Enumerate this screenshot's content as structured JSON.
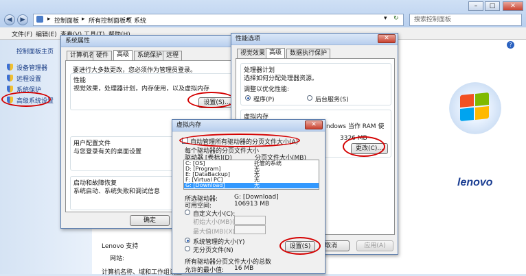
{
  "window": {
    "breadcrumb": [
      "控制面板",
      "所有控制面板项",
      "系统"
    ],
    "search_placeholder": "搜索控制面板",
    "controls": [
      "–",
      "□",
      "✕"
    ]
  },
  "menubar": [
    "文件(F)",
    "编辑(E)",
    "查看(V)",
    "工具(T)",
    "帮助(H)"
  ],
  "leftpane": {
    "home": "控制面板主页",
    "items": [
      "设备管理器",
      "远程设置",
      "系统保护",
      "高级系统设置"
    ]
  },
  "content": {
    "model_label": "Lenovo 支持",
    "website_label": "网站:",
    "computer_name_label": "计算机名称、域和工作组设置",
    "brand": "lenovo"
  },
  "sysprops": {
    "title": "系统属性",
    "tabs": [
      "计算机名",
      "硬件",
      "高级",
      "系统保护",
      "远程"
    ],
    "admin_note": "要进行大多数更改，您必须作为管理员登录。",
    "perf_title": "性能",
    "perf_desc": "视觉效果，处理器计划，内存使用，以及虚拟内存",
    "settings_btn": "设置(S)...",
    "profile_title": "用户配置文件",
    "profile_desc": "与您登录有关的桌面设置",
    "startup_title": "启动和故障恢复",
    "startup_desc": "系统启动、系统失败和调试信息",
    "ok_btn": "确定"
  },
  "perfopts": {
    "title": "性能选项",
    "tabs": [
      "视觉效果",
      "高级",
      "数据执行保护"
    ],
    "cpu_title": "处理器计划",
    "cpu_desc": "选择如何分配处理器资源。",
    "adjust_label": "调整以优化性能:",
    "opt_programs": "程序(P)",
    "opt_services": "后台服务(S)",
    "vm_title": "虚拟内存",
    "vm_frag1": "ndows 当作 RAM 使",
    "vm_frag2": "3326 MB",
    "change_btn": "更改(C)...",
    "cancel_btn": "取消",
    "apply_btn": "应用(A)"
  },
  "vmem": {
    "title": "虚拟内存",
    "auto_label": "自动管理所有驱动器的分页文件大小(A)",
    "each_drive_label": "每个驱动器的分页文件大小",
    "col_drive": "驱动器 [卷标](D)",
    "col_size": "分页文件大小(MB)",
    "rows": [
      {
        "drive": "C:     [OS]",
        "size": "托管的系统"
      },
      {
        "drive": "D:     [Program]",
        "size": "无"
      },
      {
        "drive": "E:     [DataBackup]",
        "size": "无"
      },
      {
        "drive": "F:     [Virtual PC]",
        "size": "无"
      },
      {
        "drive": "G:     [Download]",
        "size": "无"
      }
    ],
    "selected_row": 4,
    "sel_drive_label": "所选驱动器:",
    "sel_drive_value": "G:  [Download]",
    "space_label": "可用空间:",
    "space_value": "106913 MB",
    "custom_label": "自定义大小(C):",
    "initial_label": "初始大小(MB)(I):",
    "max_label": "最大值(MB)(X):",
    "sys_managed_label": "系统管理的大小(Y)",
    "no_paging_label": "无分页文件(N)",
    "set_btn": "设置(S)",
    "total_title": "所有驱动器分页文件大小的总数",
    "min_label": "允许的最小值:",
    "min_value": "16 MB"
  }
}
